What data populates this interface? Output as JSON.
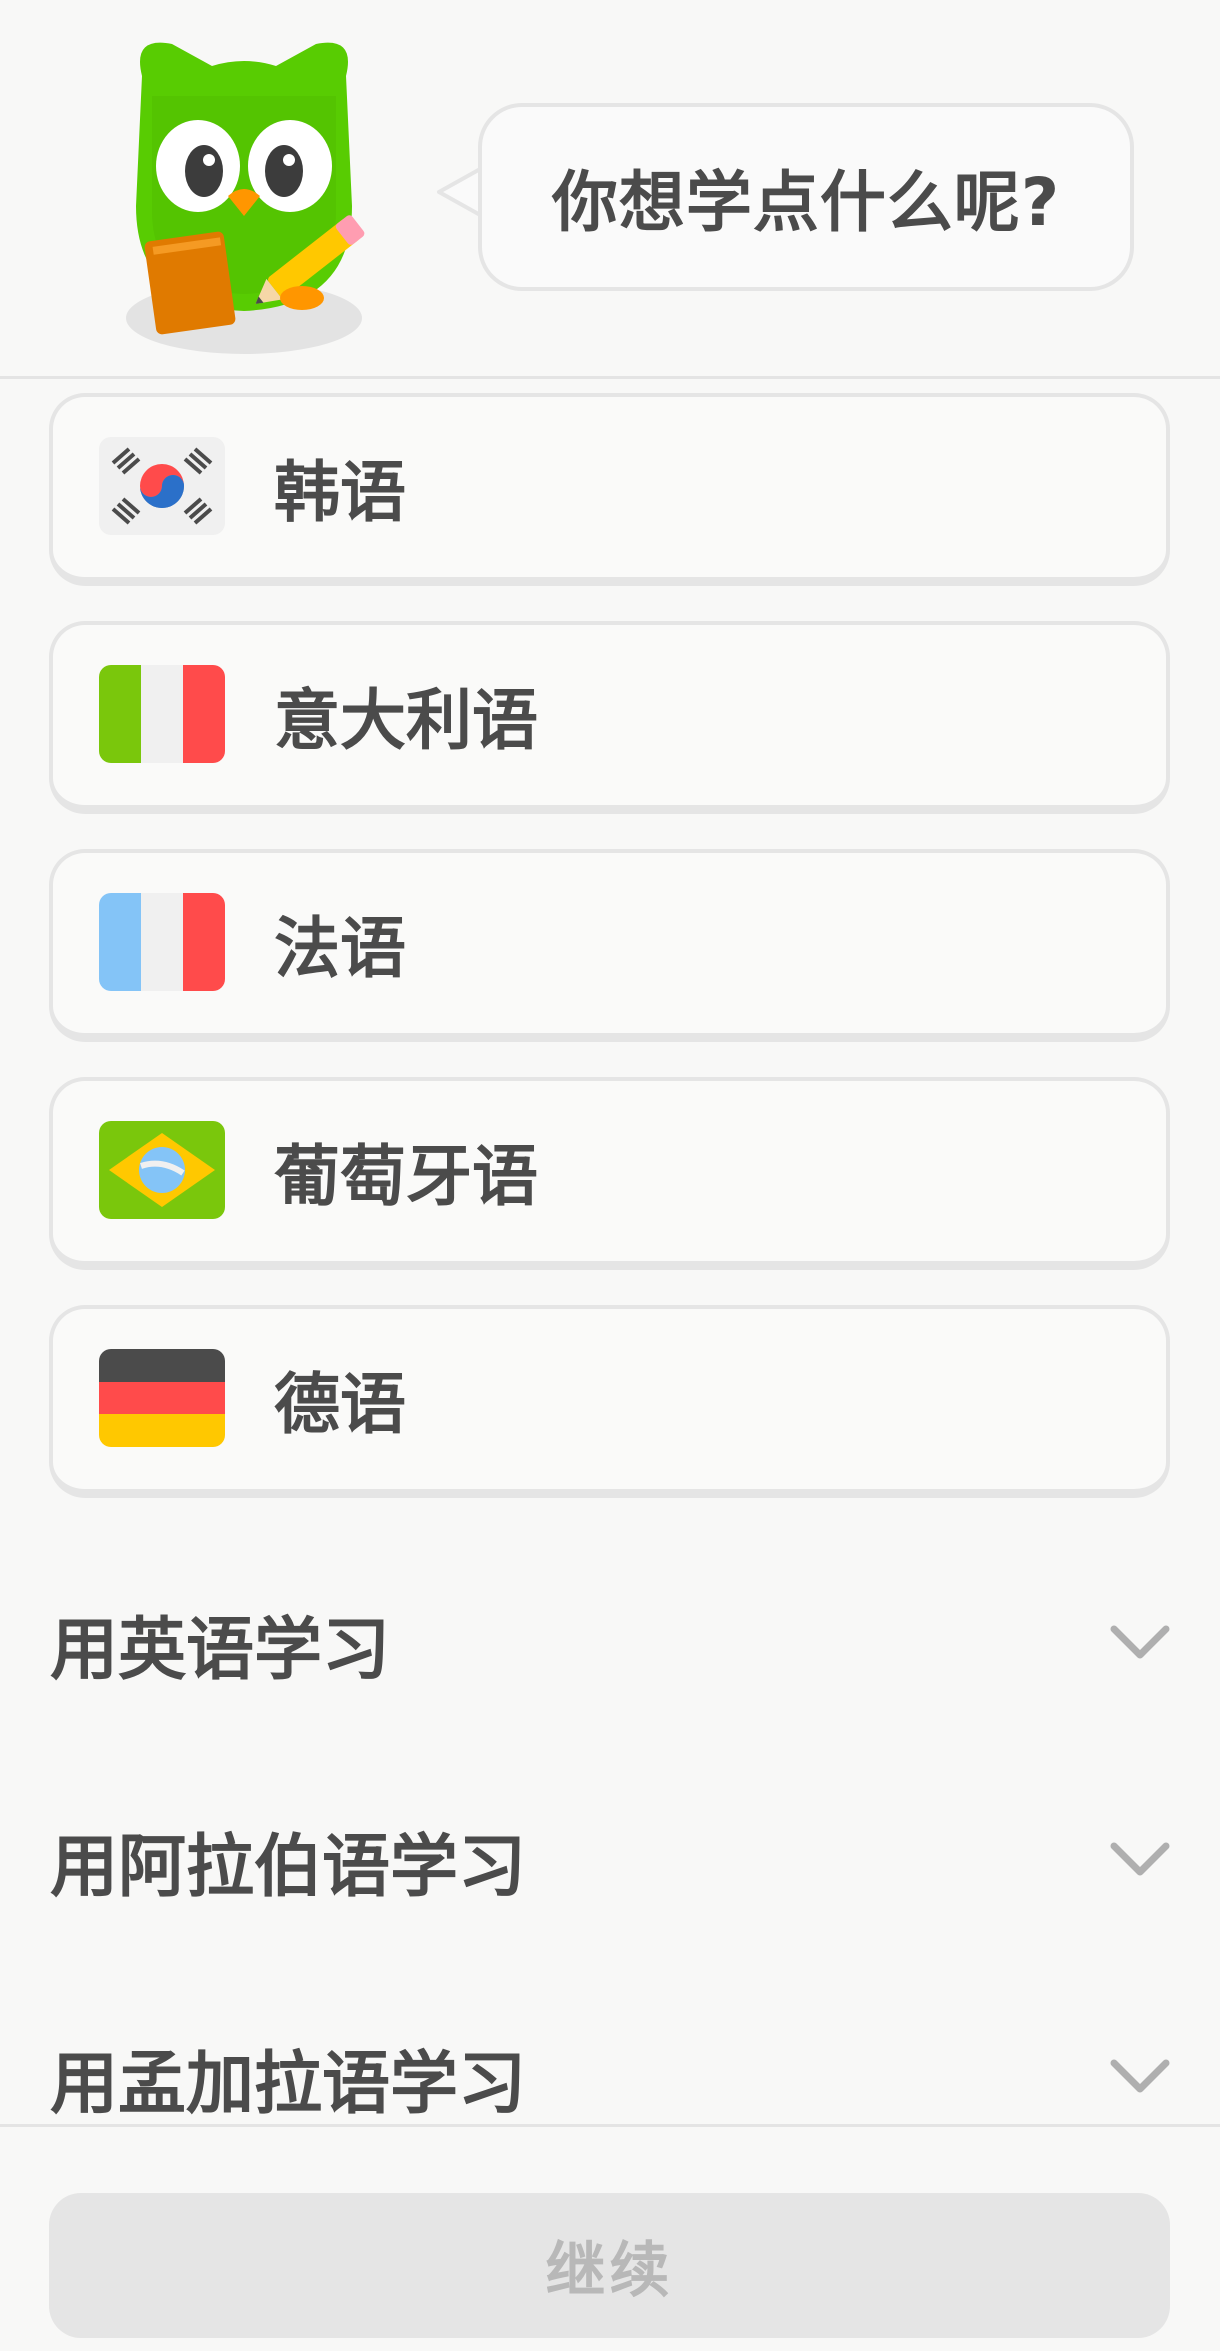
{
  "header": {
    "mascot_icon": "owl-mascot-icon",
    "prompt": "你想学点什么呢?"
  },
  "languages": [
    {
      "label": "韩语",
      "flag": "south-korea-flag-icon"
    },
    {
      "label": "意大利语",
      "flag": "italy-flag-icon"
    },
    {
      "label": "法语",
      "flag": "france-flag-icon"
    },
    {
      "label": "葡萄牙语",
      "flag": "brazil-flag-icon"
    },
    {
      "label": "德语",
      "flag": "germany-flag-icon"
    }
  ],
  "sections": [
    {
      "label": "用英语学习",
      "icon": "chevron-down-icon"
    },
    {
      "label": "用阿拉伯语学习",
      "icon": "chevron-down-icon"
    },
    {
      "label": "用孟加拉语学习",
      "icon": "chevron-down-icon"
    }
  ],
  "footer": {
    "continue_label": "继续"
  },
  "colors": {
    "background": "#f8f8f7",
    "card_border": "#e5e5e5",
    "text": "#4b4b4b",
    "button_disabled_bg": "#e5e5e5",
    "button_disabled_text": "#b8b8b8",
    "mascot_green": "#58cc02"
  }
}
